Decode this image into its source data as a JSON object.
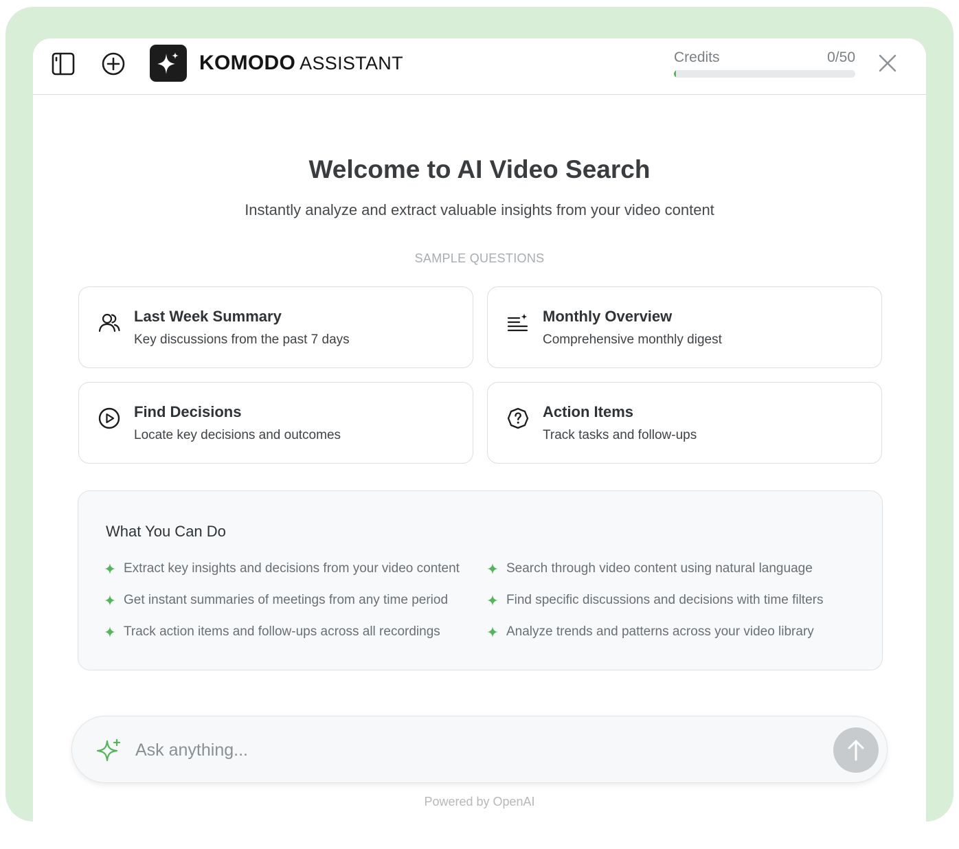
{
  "header": {
    "brand_bold": "KOMODO",
    "brand_light": "ASSISTANT",
    "credits_label": "Credits",
    "credits_value": "0/50",
    "credits_used": 0,
    "credits_total": 50,
    "icons": [
      "sidebar-toggle-icon",
      "new-chat-icon",
      "sparkle-logo-icon",
      "close-icon"
    ]
  },
  "main": {
    "title": "Welcome to AI Video Search",
    "subtitle": "Instantly analyze and extract valuable insights from your video content",
    "sample_label": "SAMPLE QUESTIONS",
    "cards": [
      {
        "title": "Last Week Summary",
        "description": "Key discussions from the past 7 days",
        "icon": "users-icon"
      },
      {
        "title": "Monthly Overview",
        "description": "Comprehensive monthly digest",
        "icon": "list-plus-icon"
      },
      {
        "title": "Find Decisions",
        "description": "Locate key decisions and outcomes",
        "icon": "play-circle-icon"
      },
      {
        "title": "Action Items",
        "description": "Track tasks and follow-ups",
        "icon": "question-badge-icon"
      }
    ]
  },
  "capabilities": {
    "title": "What You Can Do",
    "items": [
      "Extract key insights and decisions from your video content",
      "Search through video content using natural language",
      "Get instant summaries of meetings from any time period",
      "Find specific discussions and decisions with time filters",
      "Track action items and follow-ups across all recordings",
      "Analyze trends and patterns across your video library"
    ]
  },
  "composer": {
    "placeholder": "Ask anything...",
    "footer": "Powered by OpenAI"
  },
  "colors": {
    "accent_green": "#54b65a",
    "background_frame": "#d8eed7",
    "logo_bg": "#1c1c1c"
  }
}
